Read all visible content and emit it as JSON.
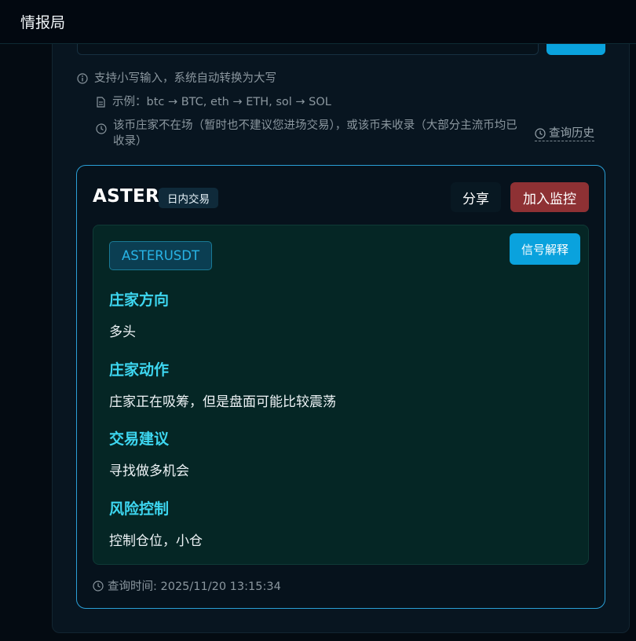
{
  "app": {
    "title": "情报局"
  },
  "hints": {
    "lowercase": "支持小写输入，系统自动转换为大写",
    "example": "示例：btc → BTC, eth → ETH, sol → SOL",
    "not_listed": "该币庄家不在场（暂时也不建议您进场交易），或该币未收录（大部分主流币均已收录）",
    "history_link": "查询历史"
  },
  "card": {
    "symbol": "ASTER",
    "trade_type": "日内交易",
    "share_label": "分享",
    "monitor_label": "加入监控",
    "pair": "ASTERUSDT",
    "explain_label": "信号解释",
    "sections": [
      {
        "heading": "庄家方向",
        "text": "多头"
      },
      {
        "heading": "庄家动作",
        "text": "庄家正在吸筹，但是盘面可能比较震荡"
      },
      {
        "heading": "交易建议",
        "text": "寻找做多机会"
      },
      {
        "heading": "风险控制",
        "text": "控制仓位，小仓"
      }
    ],
    "query_time": "查询时间: 2025/11/20 13:15:34"
  },
  "colors": {
    "accent": "#0aa2dd",
    "monitor": "#8e3134",
    "heading": "#3dd6f0",
    "pair_text": "#28b4e6"
  },
  "icons": {
    "hint_lowercase": "info-icon",
    "hint_example": "document-icon",
    "hint_not_listed": "clock-icon",
    "history": "clock-icon",
    "query_time": "clock-icon"
  }
}
